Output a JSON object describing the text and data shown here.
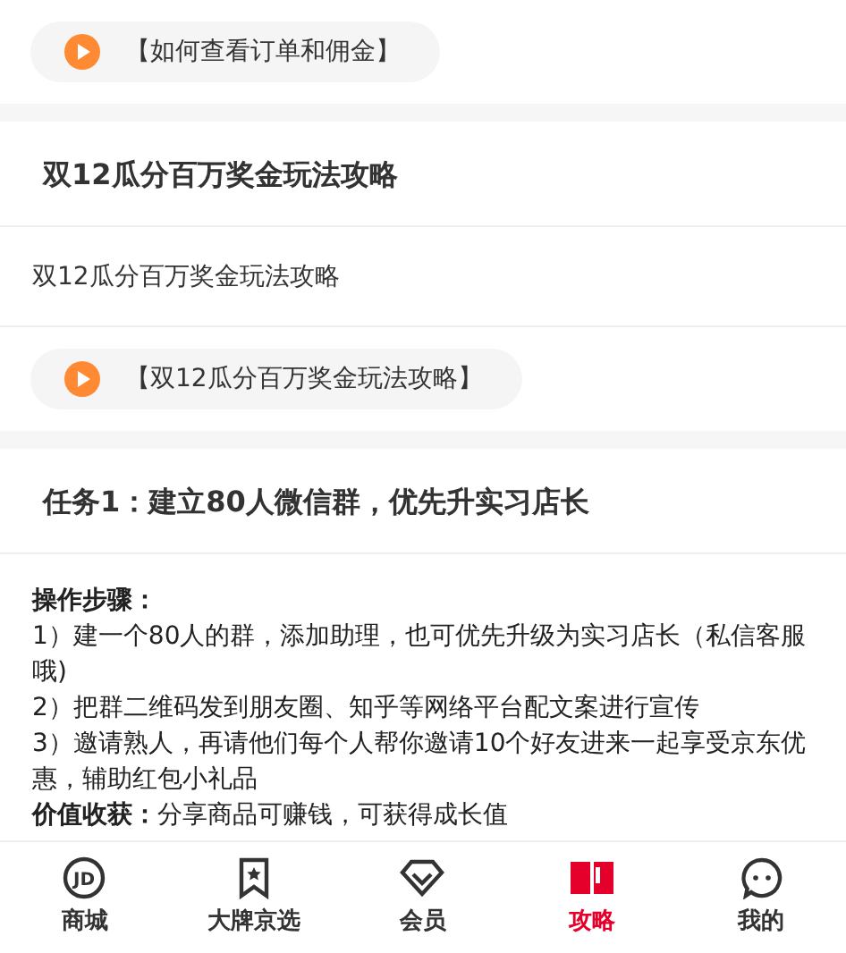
{
  "sections": [
    {
      "kind": "video",
      "video_label": "【如何查看订单和佣金】"
    },
    {
      "kind": "article",
      "title": "双12瓜分百万奖金玩法攻略",
      "body": "双12瓜分百万奖金玩法攻略",
      "video_label": "【双12瓜分百万奖金玩法攻略】"
    },
    {
      "kind": "task",
      "title": "任务1：建立80人微信群，优先升实习店长",
      "steps_heading": "操作步骤：",
      "steps": [
        "1）建一个80人的群，添加助理，也可优先升级为实习店长（私信客服哦)",
        "2）把群二维码发到朋友圈、知乎等网络平台配文案进行宣传",
        "3）邀请熟人，再请他们每个人帮你邀请10个好友进来一起享受京东优惠，辅助红包小礼品"
      ],
      "value_label": "价值收获：",
      "value_text": "分享商品可赚钱，可获得成长值"
    }
  ],
  "tabs": [
    {
      "kind": "logo",
      "logo_text": "JD",
      "label": "商城",
      "selected": false
    },
    {
      "kind": "bookmark",
      "label": "大牌京选",
      "selected": false
    },
    {
      "kind": "diamond",
      "label": "会员",
      "selected": false
    },
    {
      "kind": "book",
      "label": "攻略",
      "selected": true
    },
    {
      "kind": "chat",
      "label": "我的",
      "selected": false
    }
  ]
}
